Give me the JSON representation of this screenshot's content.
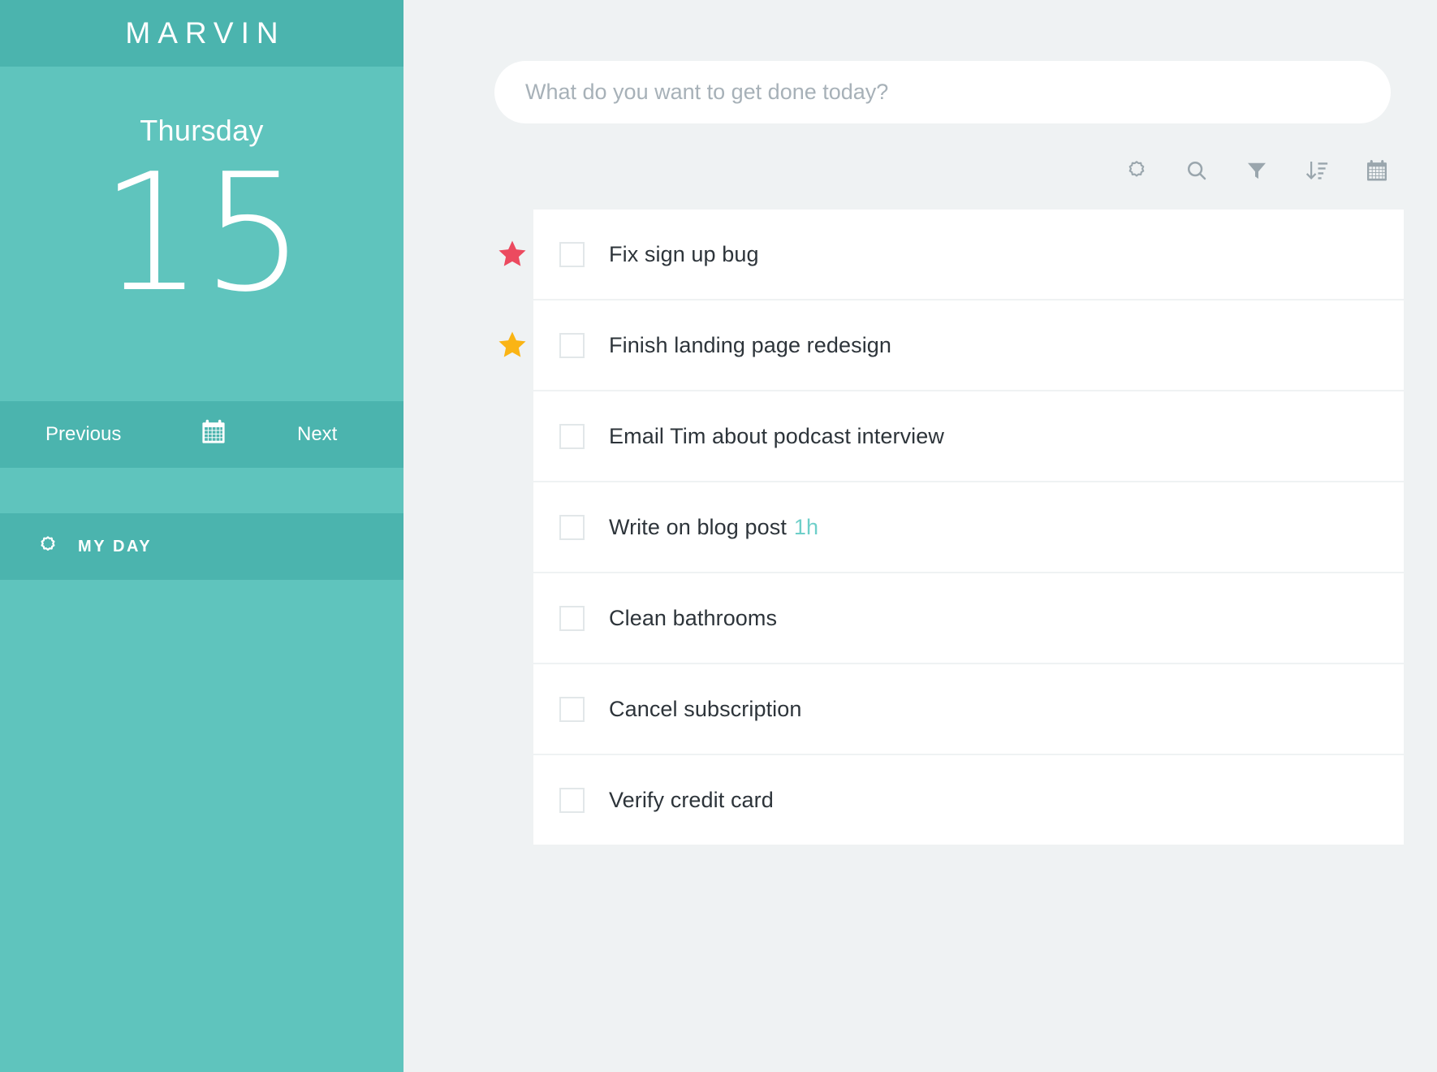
{
  "theme": {
    "brand_teal_dark": "#4bb4ae",
    "brand_teal": "#5fc4bd",
    "background": "#eff2f3",
    "card": "#ffffff",
    "text": "#2d343a",
    "muted": "#a7b1b8",
    "star_red": "#ec4a5f",
    "star_yellow": "#fab414",
    "duration_teal": "#6ecfc9"
  },
  "sidebar": {
    "brand": "MARVIN",
    "date": {
      "weekday": "Thursday",
      "day_number": "15"
    },
    "day_nav": {
      "previous_label": "Previous",
      "next_label": "Next",
      "calendar_icon": "calendar-icon"
    },
    "my_day": {
      "label": "MY DAY",
      "icon": "sun-icon"
    }
  },
  "main": {
    "quick_add": {
      "value": "",
      "placeholder": "What do you want to get done today?"
    },
    "toolbar": [
      {
        "name": "sun-icon",
        "label": "Day settings"
      },
      {
        "name": "search-icon",
        "label": "Search"
      },
      {
        "name": "filter-icon",
        "label": "Filter"
      },
      {
        "name": "sort-icon",
        "label": "Sort"
      },
      {
        "name": "calendar-icon",
        "label": "Calendar"
      }
    ],
    "tasks": [
      {
        "title": "Fix sign up bug",
        "star": "red",
        "checked": false,
        "duration": ""
      },
      {
        "title": "Finish landing page redesign",
        "star": "yellow",
        "checked": false,
        "duration": ""
      },
      {
        "title": "Email Tim about podcast interview",
        "star": "none",
        "checked": false,
        "duration": ""
      },
      {
        "title": "Write on blog post",
        "star": "none",
        "checked": false,
        "duration": "1h"
      },
      {
        "title": "Clean bathrooms",
        "star": "none",
        "checked": false,
        "duration": ""
      },
      {
        "title": "Cancel subscription",
        "star": "none",
        "checked": false,
        "duration": ""
      },
      {
        "title": "Verify credit card",
        "star": "none",
        "checked": false,
        "duration": ""
      }
    ]
  }
}
